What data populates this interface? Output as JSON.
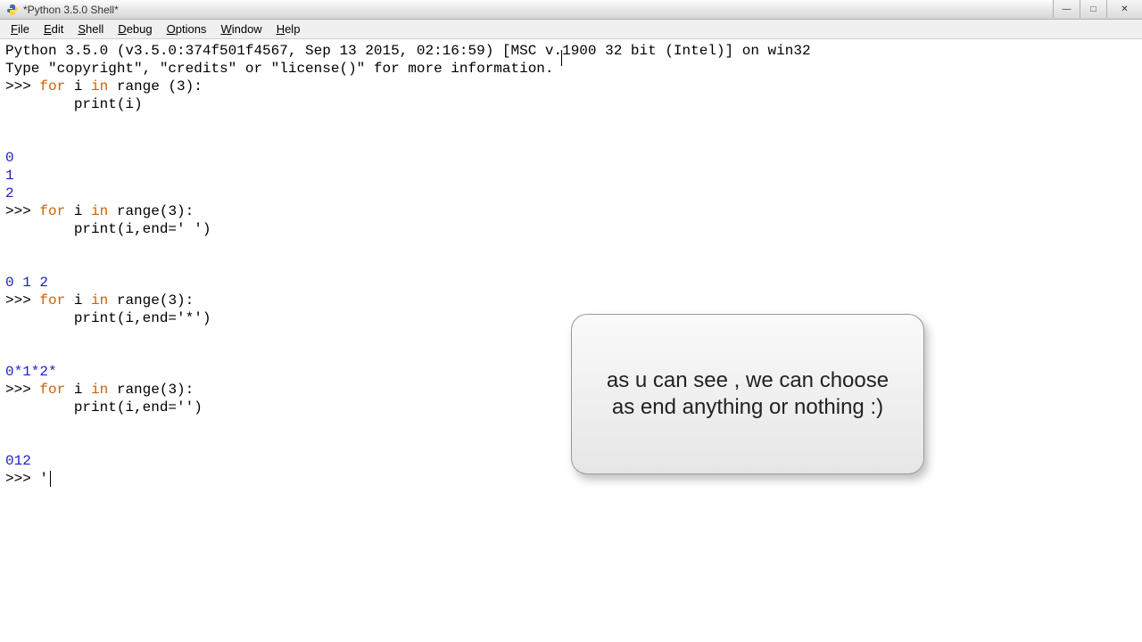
{
  "window": {
    "title": "*Python 3.5.0 Shell*"
  },
  "menu": {
    "items": [
      "File",
      "Edit",
      "Shell",
      "Debug",
      "Options",
      "Window",
      "Help"
    ]
  },
  "shell": {
    "banner1": "Python 3.5.0 (v3.5.0:374f501f4567, Sep 13 2015, 02:16:59) [MSC v.1900 32 bit (Intel)] on win32",
    "banner2": "Type \"copyright\", \"credits\" or \"license()\" for more information.",
    "prompt": ">>> ",
    "kw_for": "for",
    "kw_in": "in",
    "line1_a": " i ",
    "line1_b": " range (3):",
    "line1_body": "        print(i)",
    "out1_a": "0",
    "out1_b": "1",
    "out1_c": "2",
    "line2_b": " range(3):",
    "line2_body": "        print(i,end=' ')",
    "out2": "0 1 2 ",
    "line3_body": "        print(i,end='*')",
    "out3": "0*1*2*",
    "line4_body": "        print(i,end='')",
    "out4": "012",
    "cursor_input": "'"
  },
  "callout": {
    "text": "as u can see , we can choose as end anything or nothing :)"
  }
}
